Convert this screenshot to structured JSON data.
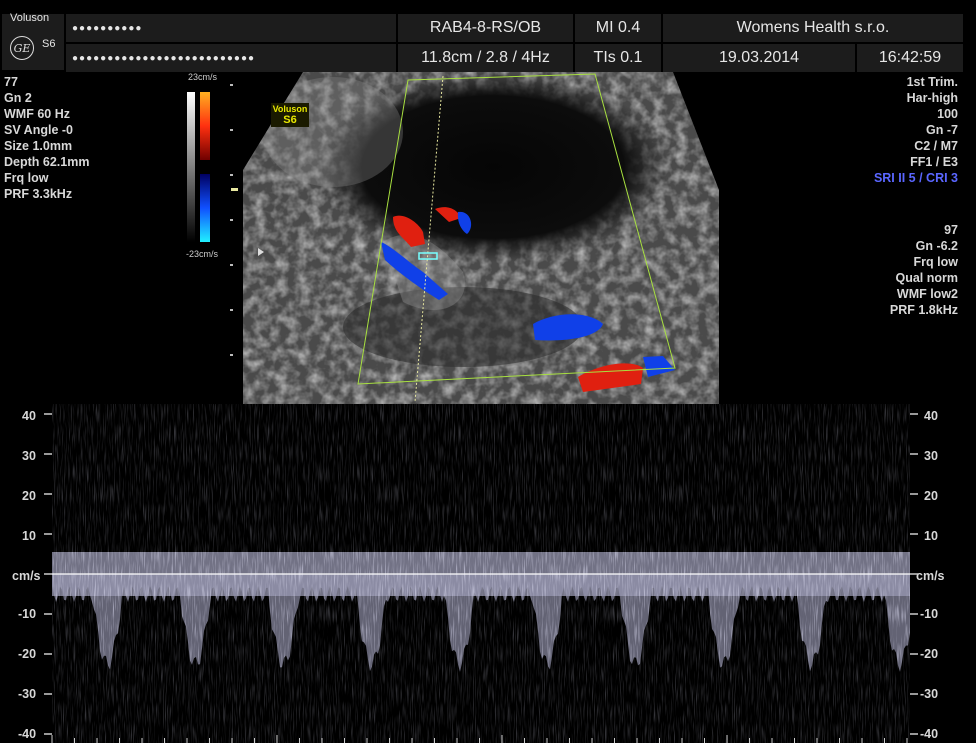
{
  "header": {
    "brand": "Voluson",
    "model": "S6",
    "logo": "GE",
    "patient_id_masked": "●●●●●●●●●●",
    "patient_name_masked": "●●●●●●●●●●●●●●●●●●●●●●●●●●",
    "probe_app": "RAB4-8-RS/OB",
    "depth_info": "11.8cm / 2.8 /  4Hz",
    "mi": "MI  0.4",
    "tis": "TIs  0.1",
    "institution": "Womens Health s.r.o.",
    "date": "19.03.2014",
    "time": "16:42:59"
  },
  "left_params": [
    "77",
    "Gn   2",
    "WMF 60 Hz",
    "SV Angle -0",
    "Size  1.0mm",
    "Depth 62.1mm",
    "Frq low",
    "PRF  3.3kHz"
  ],
  "right_params_top": [
    "1st Trim.",
    "Har-high",
    "100",
    "Gn  -7",
    "C2 / M7",
    "FF1 / E3"
  ],
  "right_sri": "SRI II 5 / CRI 3",
  "right_params_bottom": [
    "97",
    "Gn -6.2",
    "Frq low",
    "Qual norm",
    "WMF low2",
    "PRF  1.8kHz"
  ],
  "colorbar": {
    "top": "23cm/s",
    "bottom": "-23cm/s"
  },
  "image_tag": {
    "line1": "Voluson",
    "line2": "S6"
  },
  "spectrum": {
    "ticks": [
      "40",
      "30",
      "20",
      "10",
      "cm/s",
      "-10",
      "-20",
      "-30",
      "-40"
    ],
    "baseline_color": "#ffffff",
    "trace_color": "#b4b4d2"
  },
  "colors": {
    "doppler_red": "#e02010",
    "doppler_blue": "#1040e8",
    "sector_outline": "#a8e040",
    "sri_text": "#5a66ff"
  }
}
